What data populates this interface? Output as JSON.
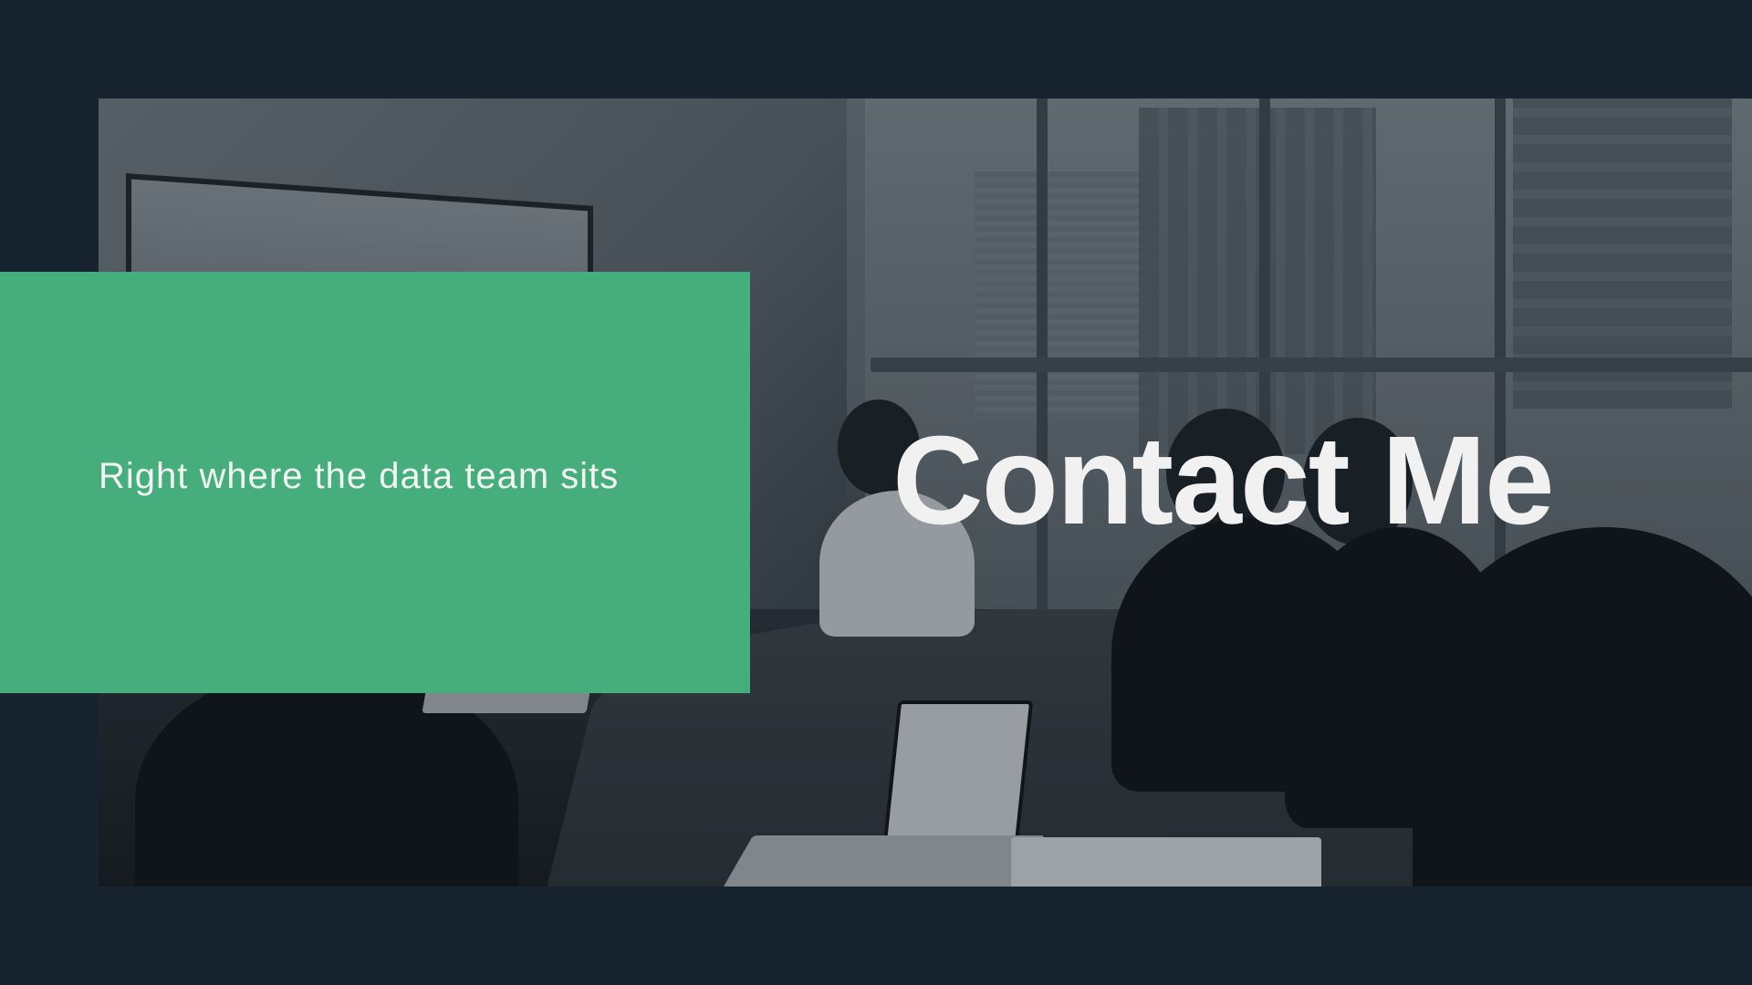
{
  "slide": {
    "title": "Contact Me",
    "subtitle": "Right where the data team sits"
  },
  "colors": {
    "background": "#17232e",
    "card": "#45ae7c",
    "text_light": "#f1f1f1"
  },
  "image": {
    "subject": "meeting-room-photo"
  }
}
